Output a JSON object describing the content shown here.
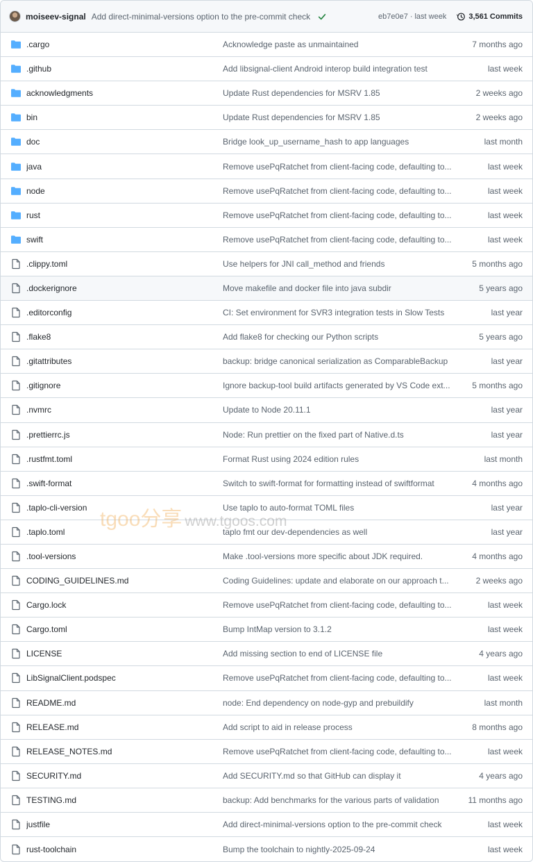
{
  "header": {
    "author": "moiseev-signal",
    "message": "Add direct-minimal-versions option to the pre-commit check",
    "hash": "eb7e0e7",
    "separator": "·",
    "time": "last week",
    "commits": "3,561 Commits",
    "check_color": "#1a7f37"
  },
  "colors": {
    "folder": "#54aeff",
    "file_icon": "#59636e",
    "text_muted": "#59636e"
  },
  "watermark": {
    "brand": "tgoo分享",
    "url": "www.tgoos.com"
  },
  "rows": [
    {
      "type": "folder",
      "name": ".cargo",
      "message": "Acknowledge paste as unmaintained",
      "time": "7 months ago"
    },
    {
      "type": "folder",
      "name": ".github",
      "message": "Add libsignal-client Android interop build integration test",
      "time": "last week"
    },
    {
      "type": "folder",
      "name": "acknowledgments",
      "message": "Update Rust dependencies for MSRV 1.85",
      "time": "2 weeks ago"
    },
    {
      "type": "folder",
      "name": "bin",
      "message": "Update Rust dependencies for MSRV 1.85",
      "time": "2 weeks ago"
    },
    {
      "type": "folder",
      "name": "doc",
      "message": "Bridge look_up_username_hash to app languages",
      "time": "last month"
    },
    {
      "type": "folder",
      "name": "java",
      "message": "Remove usePqRatchet from client-facing code, defaulting to...",
      "time": "last week"
    },
    {
      "type": "folder",
      "name": "node",
      "message": "Remove usePqRatchet from client-facing code, defaulting to...",
      "time": "last week"
    },
    {
      "type": "folder",
      "name": "rust",
      "message": "Remove usePqRatchet from client-facing code, defaulting to...",
      "time": "last week"
    },
    {
      "type": "folder",
      "name": "swift",
      "message": "Remove usePqRatchet from client-facing code, defaulting to...",
      "time": "last week"
    },
    {
      "type": "file",
      "name": ".clippy.toml",
      "message": "Use helpers for JNI call_method and friends",
      "time": "5 months ago"
    },
    {
      "type": "file",
      "name": ".dockerignore",
      "message": "Move makefile and docker file into java subdir",
      "time": "5 years ago",
      "highlighted": true
    },
    {
      "type": "file",
      "name": ".editorconfig",
      "message": "CI: Set environment for SVR3 integration tests in Slow Tests",
      "time": "last year"
    },
    {
      "type": "file",
      "name": ".flake8",
      "message": "Add flake8 for checking our Python scripts",
      "time": "5 years ago"
    },
    {
      "type": "file",
      "name": ".gitattributes",
      "message": "backup: bridge canonical serialization as ComparableBackup",
      "time": "last year"
    },
    {
      "type": "file",
      "name": ".gitignore",
      "message": "Ignore backup-tool build artifacts generated by VS Code ext...",
      "time": "5 months ago"
    },
    {
      "type": "file",
      "name": ".nvmrc",
      "message": "Update to Node 20.11.1",
      "time": "last year"
    },
    {
      "type": "file",
      "name": ".prettierrc.js",
      "message": "Node: Run prettier on the fixed part of Native.d.ts",
      "time": "last year"
    },
    {
      "type": "file",
      "name": ".rustfmt.toml",
      "message": "Format Rust using 2024 edition rules",
      "time": "last month"
    },
    {
      "type": "file",
      "name": ".swift-format",
      "message": "Switch to swift-format for formatting instead of swiftformat",
      "time": "4 months ago"
    },
    {
      "type": "file",
      "name": ".taplo-cli-version",
      "message": "Use taplo to auto-format TOML files",
      "time": "last year"
    },
    {
      "type": "file",
      "name": ".taplo.toml",
      "message": "taplo fmt our dev-dependencies as well",
      "time": "last year"
    },
    {
      "type": "file",
      "name": ".tool-versions",
      "message": "Make .tool-versions more specific about JDK required.",
      "time": "4 months ago"
    },
    {
      "type": "file",
      "name": "CODING_GUIDELINES.md",
      "message": "Coding Guidelines: update and elaborate on our approach t...",
      "time": "2 weeks ago"
    },
    {
      "type": "file",
      "name": "Cargo.lock",
      "message": "Remove usePqRatchet from client-facing code, defaulting to...",
      "time": "last week"
    },
    {
      "type": "file",
      "name": "Cargo.toml",
      "message": "Bump IntMap version to 3.1.2",
      "time": "last week"
    },
    {
      "type": "file",
      "name": "LICENSE",
      "message": "Add missing section to end of LICENSE file",
      "time": "4 years ago"
    },
    {
      "type": "file",
      "name": "LibSignalClient.podspec",
      "message": "Remove usePqRatchet from client-facing code, defaulting to...",
      "time": "last week"
    },
    {
      "type": "file",
      "name": "README.md",
      "message": "node: End dependency on node-gyp and prebuildify",
      "time": "last month"
    },
    {
      "type": "file",
      "name": "RELEASE.md",
      "message": "Add script to aid in release process",
      "time": "8 months ago"
    },
    {
      "type": "file",
      "name": "RELEASE_NOTES.md",
      "message": "Remove usePqRatchet from client-facing code, defaulting to...",
      "time": "last week"
    },
    {
      "type": "file",
      "name": "SECURITY.md",
      "message": "Add SECURITY.md so that GitHub can display it",
      "time": "4 years ago"
    },
    {
      "type": "file",
      "name": "TESTING.md",
      "message": "backup: Add benchmarks for the various parts of validation",
      "time": "11 months ago"
    },
    {
      "type": "file",
      "name": "justfile",
      "message": "Add direct-minimal-versions option to the pre-commit check",
      "time": "last week"
    },
    {
      "type": "file",
      "name": "rust-toolchain",
      "message": "Bump the toolchain to nightly-2025-09-24",
      "time": "last week"
    }
  ]
}
